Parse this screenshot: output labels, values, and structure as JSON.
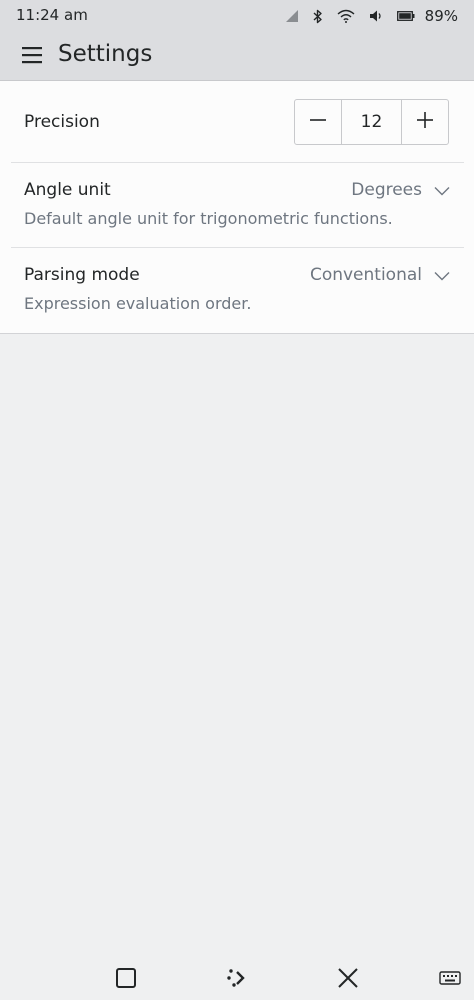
{
  "status_bar": {
    "time": "11:24 am",
    "battery_percent": "89%",
    "icons": [
      "signal-icon",
      "bluetooth-icon",
      "wifi-icon",
      "volume-icon",
      "battery-icon"
    ]
  },
  "app_bar": {
    "title": "Settings",
    "menu_icon": "hamburger-menu-icon"
  },
  "settings": {
    "precision": {
      "label": "Precision",
      "value": "12",
      "decrement_icon": "minus-icon",
      "increment_icon": "plus-icon"
    },
    "angle_unit": {
      "label": "Angle unit",
      "value": "Degrees",
      "description": "Default angle unit for trigonometric functions."
    },
    "parsing_mode": {
      "label": "Parsing mode",
      "value": "Conventional",
      "description": "Expression evaluation order."
    }
  },
  "nav_bar": {
    "icons": [
      "square-icon",
      "dots-arrow-icon",
      "close-icon",
      "keyboard-icon"
    ]
  },
  "colors": {
    "background": "#eff0f1",
    "header": "#dcdde0",
    "card": "#fcfcfc",
    "secondary_text": "#6e7680",
    "primary_text": "#232627"
  }
}
